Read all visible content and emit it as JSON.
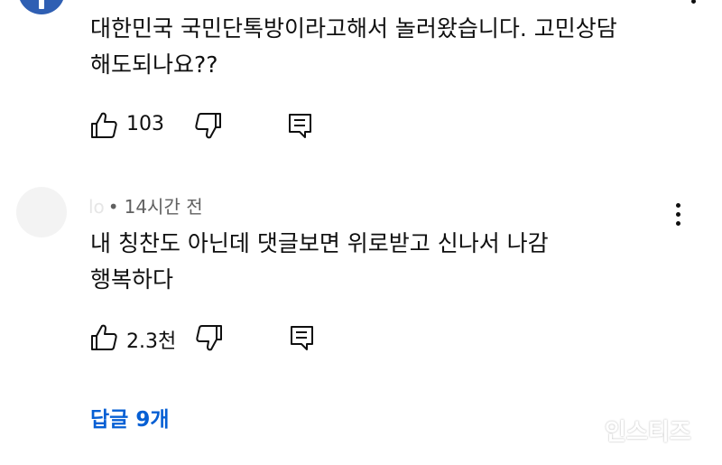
{
  "comments": [
    {
      "text_lines": [
        "대한민국 국민단톡방이라고해서 놀러왔습니다. 고민상담",
        "해도되나요??"
      ],
      "likes": "103",
      "icons": {
        "like": "thumbs-up-icon",
        "dislike": "thumbs-down-icon",
        "reply": "reply-icon",
        "more": "more-vert-icon"
      }
    },
    {
      "author_faded": "lo",
      "time": "14시간 전",
      "text_lines": [
        "내 칭찬도 아닌데 댓글보면 위로받고 신나서 나감",
        "행복하다"
      ],
      "likes": "2.3천",
      "icons": {
        "like": "thumbs-up-icon",
        "dislike": "thumbs-down-icon",
        "reply": "reply-icon",
        "more": "more-vert-icon"
      }
    }
  ],
  "replies_link": "답글 9개",
  "watermark": "인스티즈",
  "colors": {
    "text": "#0f0f0f",
    "meta": "#606060",
    "link": "#065fd4",
    "avatar": "#2f5fb3"
  }
}
